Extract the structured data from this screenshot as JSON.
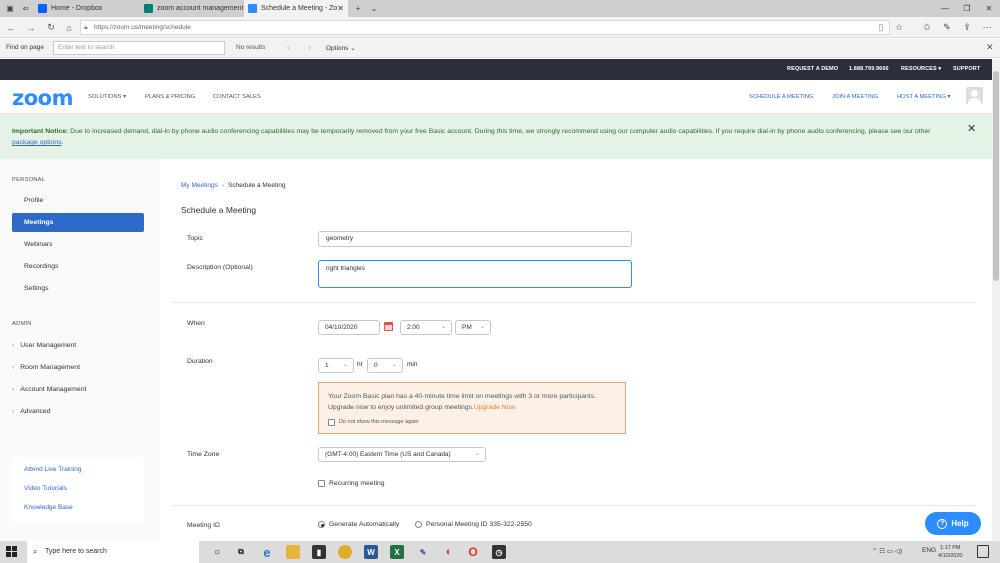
{
  "browser": {
    "tabs": [
      {
        "title": "Home - Dropbox"
      },
      {
        "title": "zoom account management"
      },
      {
        "title": "Schedule a Meeting - Zo"
      }
    ],
    "url": "https://zoom.us/meeting/schedule",
    "find": {
      "label": "Find on page",
      "placeholder": "Enter text to search",
      "result": "No results",
      "options": "Options"
    }
  },
  "zoom_top": {
    "request_demo": "REQUEST A DEMO",
    "phone": "1.888.799.9666",
    "resources": "RESOURCES ▾",
    "support": "SUPPORT"
  },
  "nav": {
    "logo": "zoom",
    "solutions": "SOLUTIONS ▾",
    "plans": "PLANS & PRICING",
    "contact": "CONTACT SALES",
    "schedule": "SCHEDULE A MEETING",
    "join": "JOIN A MEETING",
    "host": "HOST A MEETING ▾"
  },
  "notice": {
    "heading": "Important Notice:",
    "body": " Due to increased demand, dial-in by phone audio conferencing capabilities may be temporarily removed from your free Basic account. During this time, we strongly recommend using our computer audio capabilities. If you require dial-in by phone audio conferencing, please see our other ",
    "link": "package options",
    "end": "."
  },
  "sidebar": {
    "personal_label": "PERSONAL",
    "personal_items": [
      {
        "label": "Profile"
      },
      {
        "label": "Meetings"
      },
      {
        "label": "Webinars"
      },
      {
        "label": "Recordings"
      },
      {
        "label": "Settings"
      }
    ],
    "admin_label": "ADMIN",
    "admin_items": [
      {
        "label": "User Management"
      },
      {
        "label": "Room Management"
      },
      {
        "label": "Account Management"
      },
      {
        "label": "Advanced"
      }
    ],
    "help_links": [
      {
        "label": "Attend Live Training"
      },
      {
        "label": "Video Tutorials"
      },
      {
        "label": "Knowledge Base"
      }
    ]
  },
  "main": {
    "breadcrumb": {
      "parent": "My Meetings",
      "sep": "›",
      "current": "Schedule a Meeting"
    },
    "title": "Schedule a Meeting",
    "topic": {
      "label": "Topic",
      "value": "geometry"
    },
    "description": {
      "label": "Description (Optional)",
      "value": "right triangles"
    },
    "when": {
      "label": "When",
      "date": "04/10/2020",
      "time": "2:00",
      "ampm": "PM"
    },
    "duration": {
      "label": "Duration",
      "hours": "1",
      "hr_label": "hr",
      "minutes": "0",
      "min_label": "min"
    },
    "warning": {
      "line1": "Your Zoom Basic plan has a 40-minute time limit on meetings with 3 or more participants.",
      "line2": "Upgrade now to enjoy unlimited group meetings.",
      "upgrade": "Upgrade Now",
      "checkbox": "Do not show this message again"
    },
    "timezone": {
      "label": "Time Zone",
      "value": "(GMT-4:00) Eastern Time (US and Canada)"
    },
    "recurring": "Recurring meeting",
    "meeting_id": {
      "label": "Meeting ID",
      "option_auto": "Generate Automatically",
      "option_personal": "Personal Meeting ID 335-322-2550"
    },
    "help_button": "Help"
  },
  "taskbar": {
    "search_placeholder": "Type here to search",
    "lang": "ENG",
    "time": "1:17 PM",
    "date": "4/10/2020"
  },
  "colors": {
    "zoom_blue": "#2d8cff",
    "nav_dark": "#2b2f3d",
    "active_item": "#2d6ac7",
    "notice_bg": "#e5f3e6",
    "warning_border": "#f0a56b"
  }
}
